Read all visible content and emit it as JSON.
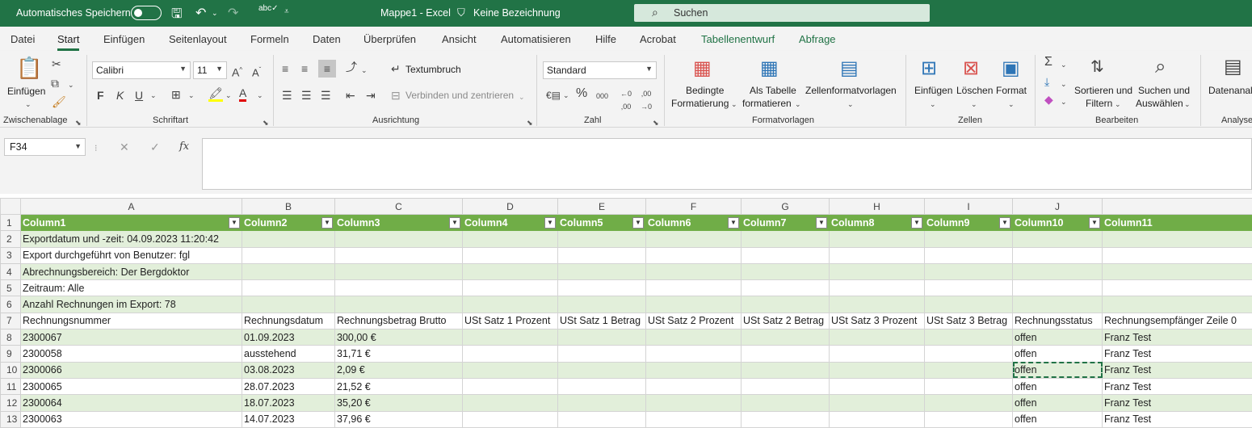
{
  "titlebar": {
    "autosave_label": "Automatisches Speichern",
    "title": "Mappe1  -  Excel",
    "sensitivity": "Keine Bezeichnung",
    "search_placeholder": "Suchen"
  },
  "tabs": [
    "Datei",
    "Start",
    "Einfügen",
    "Seitenlayout",
    "Formeln",
    "Daten",
    "Überprüfen",
    "Ansicht",
    "Automatisieren",
    "Hilfe",
    "Acrobat",
    "Tabellenentwurf",
    "Abfrage"
  ],
  "active_tab": "Start",
  "ribbon": {
    "clipboard": {
      "paste": "Einfügen",
      "group": "Zwischenablage"
    },
    "font": {
      "name": "Calibri",
      "size": "11",
      "group": "Schriftart"
    },
    "alignment": {
      "wrap": "Textumbruch",
      "merge": "Verbinden und zentrieren",
      "group": "Ausrichtung"
    },
    "number": {
      "format": "Standard",
      "group": "Zahl"
    },
    "styles": {
      "cond1": "Bedingte",
      "cond2": "Formatierung",
      "table1": "Als Tabelle",
      "table2": "formatieren",
      "cellstyles": "Zellenformatvorlagen",
      "group": "Formatvorlagen"
    },
    "cells": {
      "insert": "Einfügen",
      "delete": "Löschen",
      "format": "Format",
      "group": "Zellen"
    },
    "editing": {
      "sort1": "Sortieren und",
      "sort2": "Filtern",
      "find1": "Suchen und",
      "find2": "Auswählen",
      "group": "Bearbeiten"
    },
    "analysis": {
      "label": "Datenanalyse",
      "group": "Analyse"
    }
  },
  "formula_bar": {
    "name_box": "F34",
    "formula": ""
  },
  "columns": [
    "A",
    "B",
    "C",
    "D",
    "E",
    "F",
    "G",
    "H",
    "I",
    "J",
    ""
  ],
  "rows": [
    [
      "Column1",
      "Column2",
      "Column3",
      "Column4",
      "Column5",
      "Column6",
      "Column7",
      "Column8",
      "Column9",
      "Column10",
      "Column11"
    ],
    [
      "Exportdatum und -zeit: 04.09.2023 11:20:42",
      "",
      "",
      "",
      "",
      "",
      "",
      "",
      "",
      "",
      ""
    ],
    [
      "Export durchgeführt von Benutzer: fgl",
      "",
      "",
      "",
      "",
      "",
      "",
      "",
      "",
      "",
      ""
    ],
    [
      "Abrechnungsbereich: Der Bergdoktor",
      "",
      "",
      "",
      "",
      "",
      "",
      "",
      "",
      "",
      ""
    ],
    [
      "Zeitraum: Alle",
      "",
      "",
      "",
      "",
      "",
      "",
      "",
      "",
      "",
      ""
    ],
    [
      "Anzahl Rechnungen im Export: 78",
      "",
      "",
      "",
      "",
      "",
      "",
      "",
      "",
      "",
      ""
    ],
    [
      "Rechnungsnummer",
      "Rechnungsdatum",
      "Rechnungsbetrag Brutto",
      "USt Satz 1 Prozent",
      "USt Satz 1 Betrag",
      "USt Satz 2 Prozent",
      "USt Satz 2 Betrag",
      "USt Satz 3 Prozent",
      "USt Satz 3 Betrag",
      "Rechnungsstatus",
      "Rechnungsempfänger Zeile 0"
    ],
    [
      "2300067",
      "01.09.2023",
      "300,00 €",
      "",
      "",
      "",
      "",
      "",
      "",
      "offen",
      "Franz Test"
    ],
    [
      "2300058",
      "ausstehend",
      "31,71 €",
      "",
      "",
      "",
      "",
      "",
      "",
      "offen",
      "Franz Test"
    ],
    [
      "2300066",
      "03.08.2023",
      "2,09 €",
      "",
      "",
      "",
      "",
      "",
      "",
      "offen",
      "Franz Test"
    ],
    [
      "2300065",
      "28.07.2023",
      "21,52 €",
      "",
      "",
      "",
      "",
      "",
      "",
      "offen",
      "Franz Test"
    ],
    [
      "2300064",
      "18.07.2023",
      "35,20 €",
      "",
      "",
      "",
      "",
      "",
      "",
      "offen",
      "Franz Test"
    ],
    [
      "2300063",
      "14.07.2023",
      "37,96 €",
      "",
      "",
      "",
      "",
      "",
      "",
      "offen",
      "Franz Test"
    ]
  ],
  "copy_selection": {
    "row": 10,
    "col": "J"
  }
}
